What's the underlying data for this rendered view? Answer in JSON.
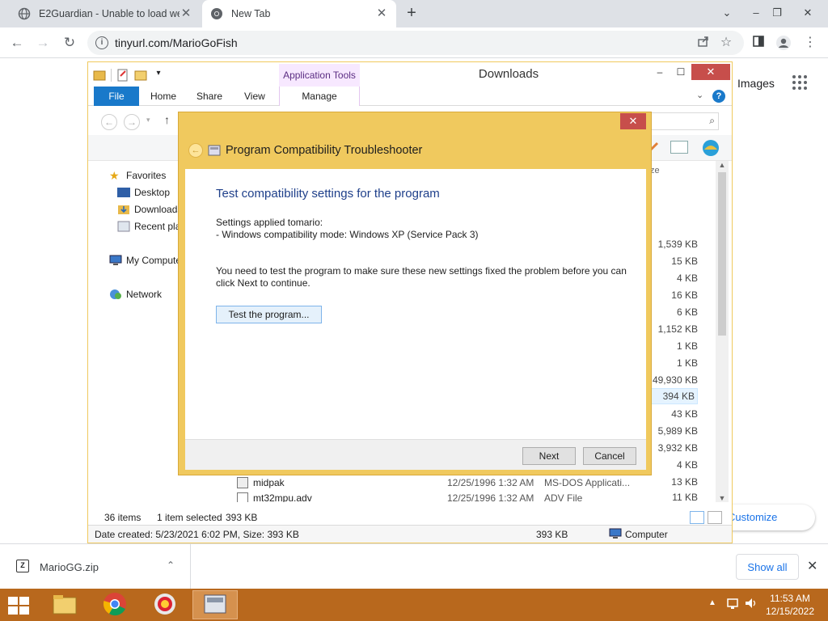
{
  "browser": {
    "tabs": [
      {
        "title": "E2Guardian - Unable to load web",
        "close": "✕"
      },
      {
        "title": "New Tab",
        "close": "✕"
      }
    ],
    "new_tab": "+",
    "window_controls": {
      "dropdown": "⌄",
      "minimize": "–",
      "restore": "❐",
      "close": "✕"
    },
    "nav": {
      "back": "←",
      "forward": "→",
      "reload": "↻"
    },
    "url": "tinyurl.com/MarioGoFish",
    "toolbar_icons": [
      "share-icon",
      "star-icon",
      "sidebar-icon",
      "profile-icon",
      "menu-icon"
    ]
  },
  "google_page": {
    "images_link": "Images",
    "customize_chrome": "Customize Chrome"
  },
  "explorer": {
    "title": "Downloads",
    "application_tools": "Application Tools",
    "ribbon_tabs": {
      "file": "File",
      "home": "Home",
      "share": "Share",
      "view": "View",
      "manage": "Manage"
    },
    "window_controls": {
      "minimize": "–",
      "maximize": "☐",
      "close": "✕"
    },
    "help": "?",
    "nav_pane": {
      "favorites": "Favorites",
      "desktop": "Desktop",
      "downloads": "Downloads",
      "recent_places": "Recent places",
      "my_computer": "My Computer",
      "network": "Network"
    },
    "size_column_header_partial": "ze",
    "sizes": [
      "1,539 KB",
      "15 KB",
      "4 KB",
      "16 KB",
      "6 KB",
      "1,152 KB",
      "1 KB",
      "1 KB",
      "49,930 KB",
      "394 KB",
      "43 KB",
      "5,989 KB",
      "3,932 KB",
      "4 KB",
      "13 KB",
      "11 KB"
    ],
    "visible_files": [
      {
        "name": "midpak",
        "date": "12/25/1996 1:32 AM",
        "type": "MS-DOS Applicati...",
        "size": "13 KB"
      },
      {
        "name": "mt32mpu.adv",
        "date": "12/25/1996 1:32 AM",
        "type": "ADV File",
        "size": "11 KB"
      }
    ],
    "status": {
      "item_count": "36 items",
      "selected": "1 item selected",
      "selected_size": "393 KB",
      "details": "Date created: 5/23/2021 6:02 PM, Size: 393 KB",
      "details_size": "393 KB",
      "location": "Computer"
    }
  },
  "dialog": {
    "title": "Program Compatibility Troubleshooter",
    "close": "✕",
    "heading": "Test compatibility settings for the program",
    "settings_applied": "Settings applied tomario:",
    "compat_mode": "- Windows compatibility mode: Windows XP (Service Pack 3)",
    "instruction_line1": "You need to test the program to make sure these new settings fixed the problem before you can",
    "instruction_line2": "click Next to continue.",
    "test_button": "Test the program...",
    "next_button": "Next",
    "cancel_button": "Cancel"
  },
  "download_shelf": {
    "file_name": "MarioGG.zip",
    "show_all": "Show all",
    "close": "✕"
  },
  "taskbar": {
    "time": "11:53 AM",
    "date": "12/15/2022"
  },
  "colors": {
    "dialog_frame": "#f0c95e",
    "taskbar": "#b8681d",
    "close_red": "#c74e4b",
    "file_tab_blue": "#1979ca",
    "heading_blue": "#1e3f8a",
    "link_blue": "#1a73e8"
  }
}
